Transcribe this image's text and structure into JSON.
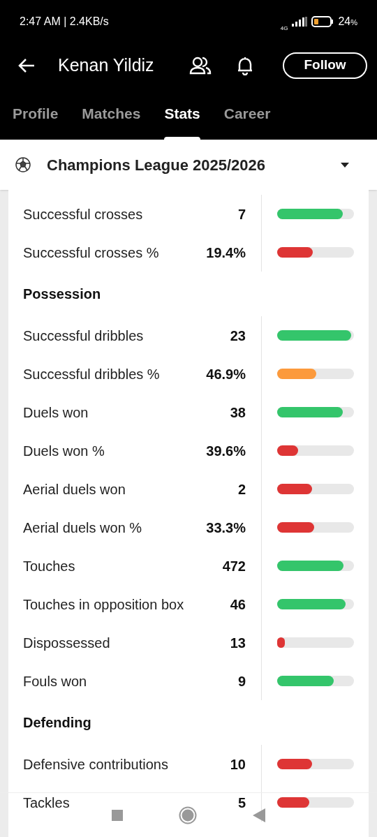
{
  "status_bar": {
    "time": "2:47 AM | 2.4KB/s",
    "network": "4G",
    "battery": "24",
    "battery_unit": "%"
  },
  "header": {
    "title": "Kenan Yildiz",
    "follow_button": "Follow"
  },
  "tabs": [
    {
      "label": "Profile",
      "selected": false
    },
    {
      "label": "Matches",
      "selected": false
    },
    {
      "label": "Stats",
      "selected": true
    },
    {
      "label": "Career",
      "selected": false
    }
  ],
  "competition": {
    "label": "Champions League 2025/2026"
  },
  "sections": [
    {
      "rows": [
        {
          "label": "Successful crosses",
          "value": "7",
          "level": 0.85,
          "color": "#34c56b"
        },
        {
          "label": "Successful crosses %",
          "value": "19.4%",
          "level": 0.46,
          "color": "#de3535"
        }
      ]
    },
    {
      "title": "Possession",
      "rows": [
        {
          "label": "Successful dribbles",
          "value": "23",
          "level": 0.96,
          "color": "#34c56b"
        },
        {
          "label": "Successful dribbles %",
          "value": "46.9%",
          "level": 0.51,
          "color": "#fc9a3c"
        },
        {
          "label": "Duels won",
          "value": "38",
          "level": 0.85,
          "color": "#34c56b"
        },
        {
          "label": "Duels won %",
          "value": "39.6%",
          "level": 0.27,
          "color": "#de3535"
        },
        {
          "label": "Aerial duels won",
          "value": "2",
          "level": 0.45,
          "color": "#de3535"
        },
        {
          "label": "Aerial duels won %",
          "value": "33.3%",
          "level": 0.48,
          "color": "#de3535"
        },
        {
          "label": "Touches",
          "value": "472",
          "level": 0.86,
          "color": "#34c56b"
        },
        {
          "label": "Touches in opposition box",
          "value": "46",
          "level": 0.89,
          "color": "#34c56b"
        },
        {
          "label": "Dispossessed",
          "value": "13",
          "level": 0.1,
          "color": "#de3535"
        },
        {
          "label": "Fouls won",
          "value": "9",
          "level": 0.74,
          "color": "#34c56b"
        }
      ]
    },
    {
      "title": "Defending",
      "rows": [
        {
          "label": "Defensive contributions",
          "value": "10",
          "level": 0.45,
          "color": "#de3535"
        },
        {
          "label": "Tackles",
          "value": "5",
          "level": 0.42,
          "color": "#de3535"
        }
      ]
    }
  ]
}
